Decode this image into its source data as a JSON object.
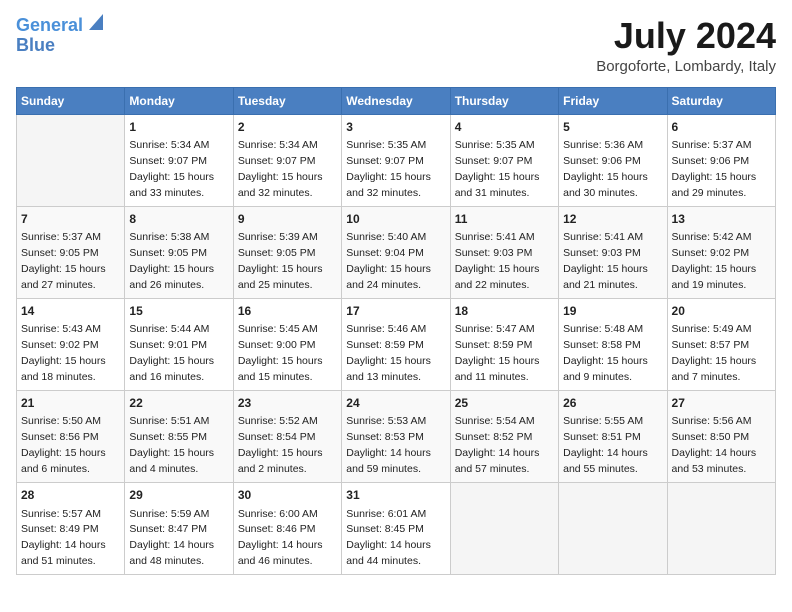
{
  "header": {
    "logo_line1": "General",
    "logo_line2": "Blue",
    "month_title": "July 2024",
    "location": "Borgoforte, Lombardy, Italy"
  },
  "weekdays": [
    "Sunday",
    "Monday",
    "Tuesday",
    "Wednesday",
    "Thursday",
    "Friday",
    "Saturday"
  ],
  "weeks": [
    [
      {
        "day": "",
        "info": ""
      },
      {
        "day": "1",
        "info": "Sunrise: 5:34 AM\nSunset: 9:07 PM\nDaylight: 15 hours\nand 33 minutes."
      },
      {
        "day": "2",
        "info": "Sunrise: 5:34 AM\nSunset: 9:07 PM\nDaylight: 15 hours\nand 32 minutes."
      },
      {
        "day": "3",
        "info": "Sunrise: 5:35 AM\nSunset: 9:07 PM\nDaylight: 15 hours\nand 32 minutes."
      },
      {
        "day": "4",
        "info": "Sunrise: 5:35 AM\nSunset: 9:07 PM\nDaylight: 15 hours\nand 31 minutes."
      },
      {
        "day": "5",
        "info": "Sunrise: 5:36 AM\nSunset: 9:06 PM\nDaylight: 15 hours\nand 30 minutes."
      },
      {
        "day": "6",
        "info": "Sunrise: 5:37 AM\nSunset: 9:06 PM\nDaylight: 15 hours\nand 29 minutes."
      }
    ],
    [
      {
        "day": "7",
        "info": "Sunrise: 5:37 AM\nSunset: 9:05 PM\nDaylight: 15 hours\nand 27 minutes."
      },
      {
        "day": "8",
        "info": "Sunrise: 5:38 AM\nSunset: 9:05 PM\nDaylight: 15 hours\nand 26 minutes."
      },
      {
        "day": "9",
        "info": "Sunrise: 5:39 AM\nSunset: 9:05 PM\nDaylight: 15 hours\nand 25 minutes."
      },
      {
        "day": "10",
        "info": "Sunrise: 5:40 AM\nSunset: 9:04 PM\nDaylight: 15 hours\nand 24 minutes."
      },
      {
        "day": "11",
        "info": "Sunrise: 5:41 AM\nSunset: 9:03 PM\nDaylight: 15 hours\nand 22 minutes."
      },
      {
        "day": "12",
        "info": "Sunrise: 5:41 AM\nSunset: 9:03 PM\nDaylight: 15 hours\nand 21 minutes."
      },
      {
        "day": "13",
        "info": "Sunrise: 5:42 AM\nSunset: 9:02 PM\nDaylight: 15 hours\nand 19 minutes."
      }
    ],
    [
      {
        "day": "14",
        "info": "Sunrise: 5:43 AM\nSunset: 9:02 PM\nDaylight: 15 hours\nand 18 minutes."
      },
      {
        "day": "15",
        "info": "Sunrise: 5:44 AM\nSunset: 9:01 PM\nDaylight: 15 hours\nand 16 minutes."
      },
      {
        "day": "16",
        "info": "Sunrise: 5:45 AM\nSunset: 9:00 PM\nDaylight: 15 hours\nand 15 minutes."
      },
      {
        "day": "17",
        "info": "Sunrise: 5:46 AM\nSunset: 8:59 PM\nDaylight: 15 hours\nand 13 minutes."
      },
      {
        "day": "18",
        "info": "Sunrise: 5:47 AM\nSunset: 8:59 PM\nDaylight: 15 hours\nand 11 minutes."
      },
      {
        "day": "19",
        "info": "Sunrise: 5:48 AM\nSunset: 8:58 PM\nDaylight: 15 hours\nand 9 minutes."
      },
      {
        "day": "20",
        "info": "Sunrise: 5:49 AM\nSunset: 8:57 PM\nDaylight: 15 hours\nand 7 minutes."
      }
    ],
    [
      {
        "day": "21",
        "info": "Sunrise: 5:50 AM\nSunset: 8:56 PM\nDaylight: 15 hours\nand 6 minutes."
      },
      {
        "day": "22",
        "info": "Sunrise: 5:51 AM\nSunset: 8:55 PM\nDaylight: 15 hours\nand 4 minutes."
      },
      {
        "day": "23",
        "info": "Sunrise: 5:52 AM\nSunset: 8:54 PM\nDaylight: 15 hours\nand 2 minutes."
      },
      {
        "day": "24",
        "info": "Sunrise: 5:53 AM\nSunset: 8:53 PM\nDaylight: 14 hours\nand 59 minutes."
      },
      {
        "day": "25",
        "info": "Sunrise: 5:54 AM\nSunset: 8:52 PM\nDaylight: 14 hours\nand 57 minutes."
      },
      {
        "day": "26",
        "info": "Sunrise: 5:55 AM\nSunset: 8:51 PM\nDaylight: 14 hours\nand 55 minutes."
      },
      {
        "day": "27",
        "info": "Sunrise: 5:56 AM\nSunset: 8:50 PM\nDaylight: 14 hours\nand 53 minutes."
      }
    ],
    [
      {
        "day": "28",
        "info": "Sunrise: 5:57 AM\nSunset: 8:49 PM\nDaylight: 14 hours\nand 51 minutes."
      },
      {
        "day": "29",
        "info": "Sunrise: 5:59 AM\nSunset: 8:47 PM\nDaylight: 14 hours\nand 48 minutes."
      },
      {
        "day": "30",
        "info": "Sunrise: 6:00 AM\nSunset: 8:46 PM\nDaylight: 14 hours\nand 46 minutes."
      },
      {
        "day": "31",
        "info": "Sunrise: 6:01 AM\nSunset: 8:45 PM\nDaylight: 14 hours\nand 44 minutes."
      },
      {
        "day": "",
        "info": ""
      },
      {
        "day": "",
        "info": ""
      },
      {
        "day": "",
        "info": ""
      }
    ]
  ]
}
